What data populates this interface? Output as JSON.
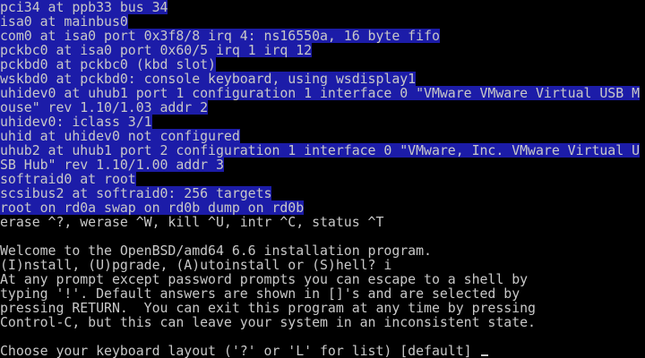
{
  "colors": {
    "background": "#000000",
    "text": "#c8c8c8",
    "kernel_highlight": "#1c1ca8"
  },
  "kernel_messages": [
    "pci34 at ppb33 bus 34",
    "isa0 at mainbus0",
    "com0 at isa0 port 0x3f8/8 irq 4: ns16550a, 16 byte fifo",
    "pckbc0 at isa0 port 0x60/5 irq 1 irq 12",
    "pckbd0 at pckbc0 (kbd slot)",
    "wskbd0 at pckbd0: console keyboard, using wsdisplay1",
    "uhidev0 at uhub1 port 1 configuration 1 interface 0 \"VMware VMware Virtual USB M",
    "ouse\" rev 1.10/1.03 addr 2",
    "uhidev0: iclass 3/1",
    "uhid at uhidev0 not configured",
    "uhub2 at uhub1 port 2 configuration 1 interface 0 \"VMware, Inc. VMware Virtual U",
    "SB Hub\" rev 1.10/1.00 addr 3",
    "softraid0 at root",
    "scsibus2 at softraid0: 256 targets",
    "root on rd0a swap on rd0b dump on rd0b"
  ],
  "console_output": [
    "erase ^?, werase ^W, kill ^U, intr ^C, status ^T",
    "",
    "Welcome to the OpenBSD/amd64 6.6 installation program.",
    "(I)nstall, (U)pgrade, (A)utoinstall or (S)hell? i",
    "At any prompt except password prompts you can escape to a shell by",
    "typing '!'. Default answers are shown in []'s and are selected by",
    "pressing RETURN.  You can exit this program at any time by pressing",
    "Control-C, but this can leave your system in an inconsistent state.",
    ""
  ],
  "prompt": "Choose your keyboard layout ('?' or 'L' for list) [default] "
}
